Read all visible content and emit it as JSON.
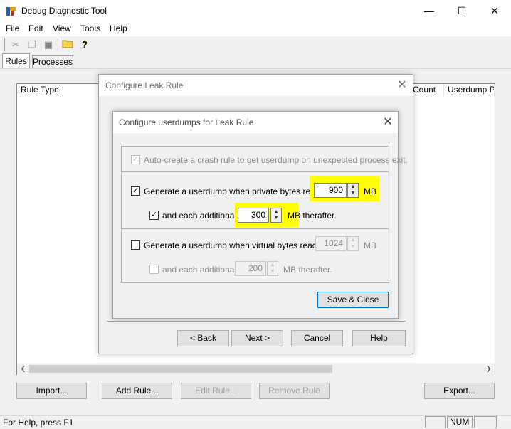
{
  "window": {
    "title": "Debug Diagnostic Tool",
    "minimize": "—",
    "maximize": "☐",
    "close": "✕"
  },
  "menu": [
    "File",
    "Edit",
    "View",
    "Tools",
    "Help"
  ],
  "toolbar_icons": [
    "cut-icon",
    "copy-icon",
    "paste-icon",
    "open-folder-icon",
    "help-icon"
  ],
  "tabs": [
    "Rules",
    "Processes"
  ],
  "list": {
    "columns": [
      "Rule Type",
      "Count",
      "Userdump Pat"
    ]
  },
  "bottom_buttons": {
    "import": "Import...",
    "add_rule": "Add Rule...",
    "edit_rule": "Edit Rule...",
    "remove_rule": "Remove Rule",
    "export": "Export..."
  },
  "status": {
    "text": "For Help, press F1",
    "num": "NUM"
  },
  "outer_dialog": {
    "title": "Configure Leak Rule",
    "back": "< Back",
    "next": "Next >",
    "cancel": "Cancel",
    "help": "Help"
  },
  "inner_dialog": {
    "title": "Configure userdumps for Leak Rule",
    "auto_crash_label": "Auto-create a crash rule to get userdump on unexpected process exit.",
    "private_label": "Generate a userdump when private bytes reach",
    "private_value": "900",
    "private_unit": "MB",
    "private_additional_label": "and each additional",
    "private_additional_value": "300",
    "private_additional_unit": "MB therafter.",
    "virtual_label": "Generate a userdump when virtual bytes reach",
    "virtual_value": "1024",
    "virtual_unit": "MB",
    "virtual_additional_label": "and each additional",
    "virtual_additional_value": "200",
    "virtual_additional_unit": "MB therafter.",
    "save_close": "Save & Close"
  },
  "colors": {
    "highlight": "#ffff00",
    "default_button_border": "#0078d7"
  }
}
